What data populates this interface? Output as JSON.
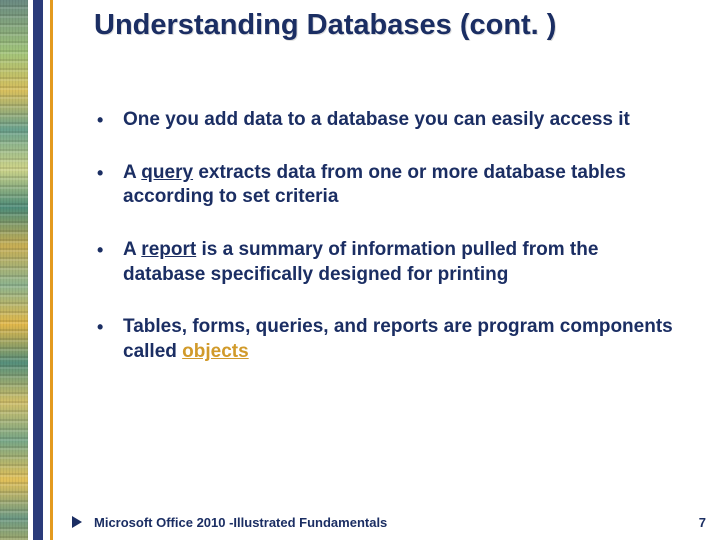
{
  "title": "Understanding Databases (cont. )",
  "bullets": [
    {
      "pre": "One you add data to a database you can easily access it",
      "kw": "",
      "kwClass": "",
      "post": ""
    },
    {
      "pre": "A ",
      "kw": "query",
      "kwClass": "kw-query",
      "post": " extracts data from one or more database tables according to set criteria"
    },
    {
      "pre": "A ",
      "kw": "report",
      "kwClass": "kw-report",
      "post": " is a summary of information pulled from the database specifically designed for printing"
    },
    {
      "pre": "Tables, forms, queries, and reports are program components called ",
      "kw": "objects",
      "kwClass": "kw-objects",
      "post": ""
    }
  ],
  "footer": {
    "text": "Microsoft Office 2010 -Illustrated Fundamentals",
    "page": "7"
  }
}
